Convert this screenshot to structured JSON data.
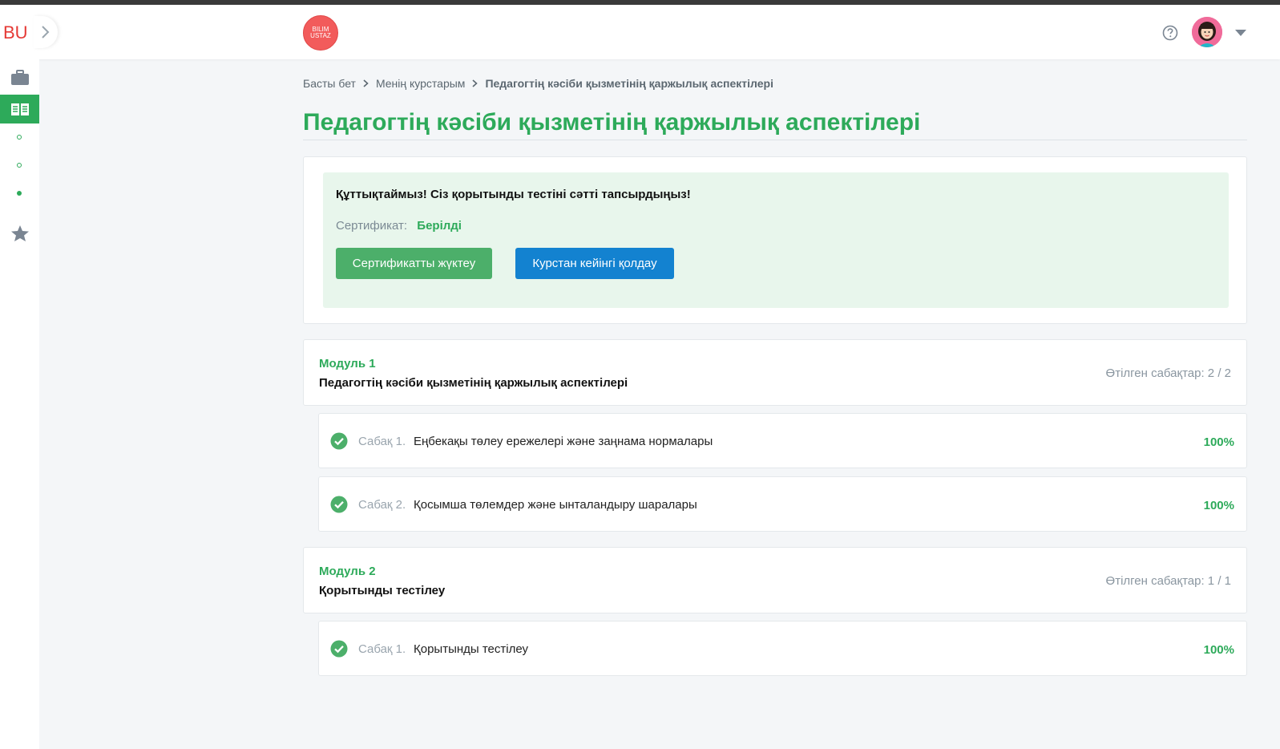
{
  "header": {
    "bu_logo": "BU",
    "brand_logo_line1": "BILIM",
    "brand_logo_line2": "USTAZ"
  },
  "icons": {
    "sidebar": [
      "briefcase-icon",
      "book-icon",
      "star-icon"
    ],
    "header": [
      "chevron-right-icon",
      "help-icon",
      "chevron-down-icon"
    ],
    "lesson_status": "check-circle-icon"
  },
  "colors": {
    "accent_green": "#2daa5a",
    "button_green": "#4caf6a",
    "button_blue": "#1382d0",
    "cert_background": "#e8f6ec",
    "logo_red": "#f25b5b"
  },
  "breadcrumb": {
    "home": "Басты бет",
    "courses": "Менің курстарым",
    "current": "Педагогтің кәсіби қызметінің қаржылық аспектілері"
  },
  "page_title": "Педагогтің кәсіби қызметінің қаржылық аспектілері",
  "certificate": {
    "congrats": "Құттықтаймыз! Сіз қорытынды тестіні сәтті тапсырдыңыз!",
    "label": "Сертификат:",
    "value": "Берілді",
    "download_button": "Сертификатты жүктеу",
    "support_button": "Курстан кейінгі қолдау"
  },
  "modules": [
    {
      "label": "Модуль 1",
      "title": "Педагогтің кәсіби қызметінің қаржылық аспектілері",
      "progress": "Өтілген сабақтар: 2 / 2",
      "lessons": [
        {
          "num": "Сабақ 1.",
          "title": "Еңбекақы төлеу ережелері және заңнама нормалары",
          "pct": "100%"
        },
        {
          "num": "Сабақ 2.",
          "title": "Қосымша төлемдер және ынталандыру шаралары",
          "pct": "100%"
        }
      ]
    },
    {
      "label": "Модуль 2",
      "title": "Қорытынды тестілеу",
      "progress": "Өтілген сабақтар: 1 / 1",
      "lessons": [
        {
          "num": "Сабақ 1.",
          "title": "Қорытынды тестілеу",
          "pct": "100%"
        }
      ]
    }
  ]
}
